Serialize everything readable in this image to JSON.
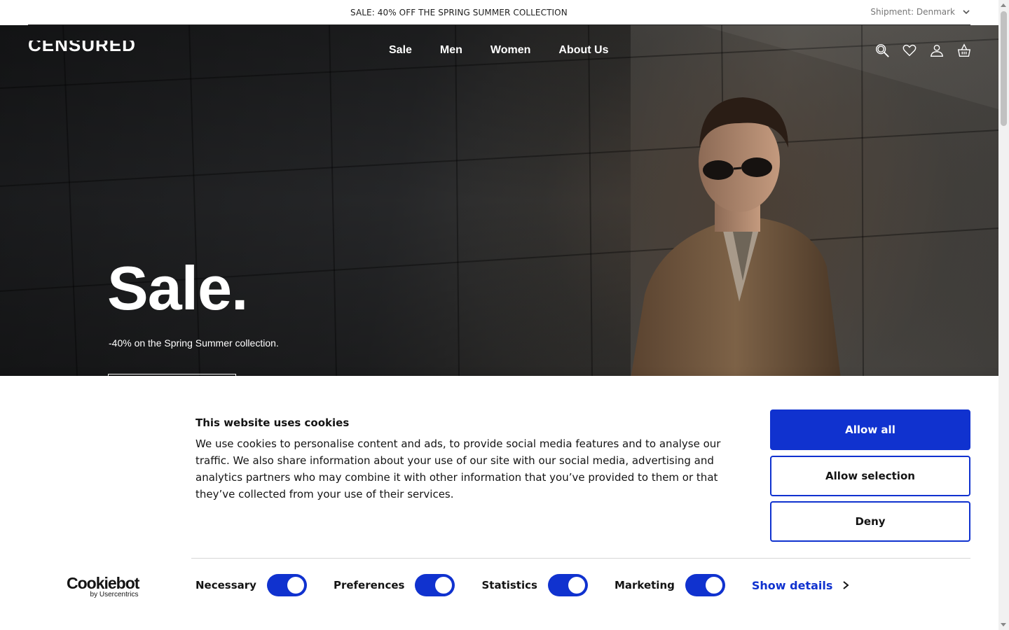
{
  "topbar": {
    "message": "SALE: 40% OFF THE SPRING SUMMER COLLECTION",
    "shipment": "Shipment: Denmark",
    "shipment_icon": "chevron-down-icon"
  },
  "header": {
    "logo": "CENSURED",
    "nav": [
      "Sale",
      "Men",
      "Women",
      "About Us"
    ],
    "icons": [
      "search-icon",
      "heart-icon",
      "user-icon",
      "basket-icon"
    ]
  },
  "hero": {
    "title": "Sale.",
    "subtitle": "-40% on the Spring Summer collection."
  },
  "cookie": {
    "title": "This website uses cookies",
    "text": "We use cookies to personalise content and ads, to provide social media features and to analyse our traffic. We also share information about your use of our site with our social media, advertising and analytics partners who may combine it with other information that you’ve provided to them or that they’ve collected from your use of their services.",
    "buttons": {
      "allow_all": "Allow all",
      "allow_selection": "Allow selection",
      "deny": "Deny"
    },
    "brand": "Cookiebot",
    "brand_sub": "by Usercentrics",
    "toggles": [
      {
        "label": "Necessary",
        "on": true
      },
      {
        "label": "Preferences",
        "on": true
      },
      {
        "label": "Statistics",
        "on": true
      },
      {
        "label": "Marketing",
        "on": true
      }
    ],
    "show_details": "Show details",
    "accent": "#1032cf"
  }
}
